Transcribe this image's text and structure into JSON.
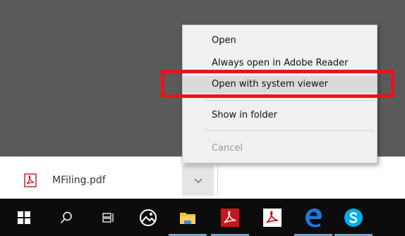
{
  "context_menu": {
    "items": [
      {
        "label": "Open"
      },
      {
        "label": "Always open in Adobe Reader"
      },
      {
        "label": "Open with system viewer"
      },
      {
        "label": "Show in folder"
      },
      {
        "label": "Cancel"
      }
    ],
    "highlighted_index": 2
  },
  "download_bar": {
    "filename": "MFiling.pdf"
  },
  "taskbar": {
    "icons": [
      "windows-start-icon",
      "search-icon",
      "task-view-icon",
      "photos-icon",
      "file-explorer-icon",
      "acrobat-icon",
      "acrobat-reader-icon",
      "edge-icon",
      "skype-icon"
    ]
  },
  "colors": {
    "annotation_red": "#e8141c",
    "menu_bg": "#f0f0f0",
    "menu_highlight": "#dadada",
    "taskbar_bg": "#0c0c0c",
    "pdf_red": "#c8161d",
    "edge_blue": "#1e78d6",
    "skype_blue": "#00aff0",
    "explorer_yellow": "#f4c230"
  }
}
